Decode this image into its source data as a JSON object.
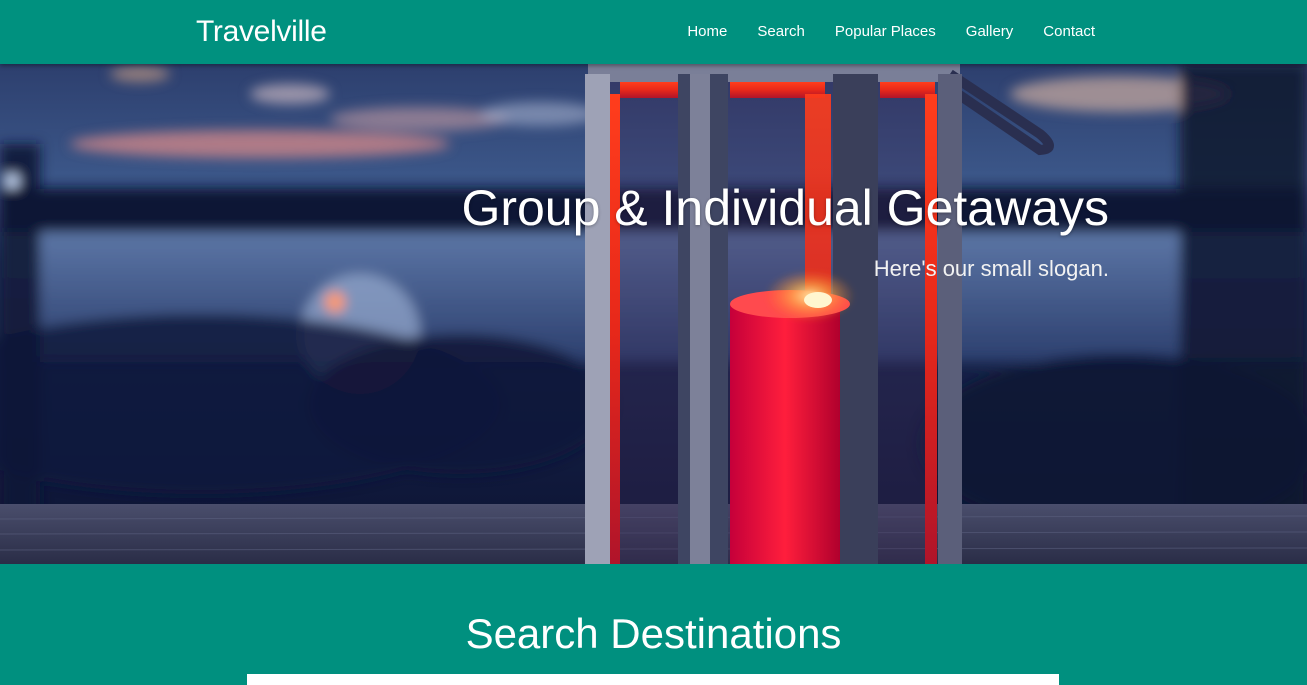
{
  "navbar": {
    "brand": "Travelville",
    "links": [
      "Home",
      "Search",
      "Popular Places",
      "Gallery",
      "Contact"
    ]
  },
  "hero": {
    "title": "Group & Individual Getaways",
    "slogan": "Here's our small slogan.",
    "image_description_icon": "lantern-candle-photo"
  },
  "search": {
    "title": "Search Destinations",
    "placeholder": ""
  },
  "colors": {
    "brand": "#00917f",
    "text": "#ffffff"
  }
}
